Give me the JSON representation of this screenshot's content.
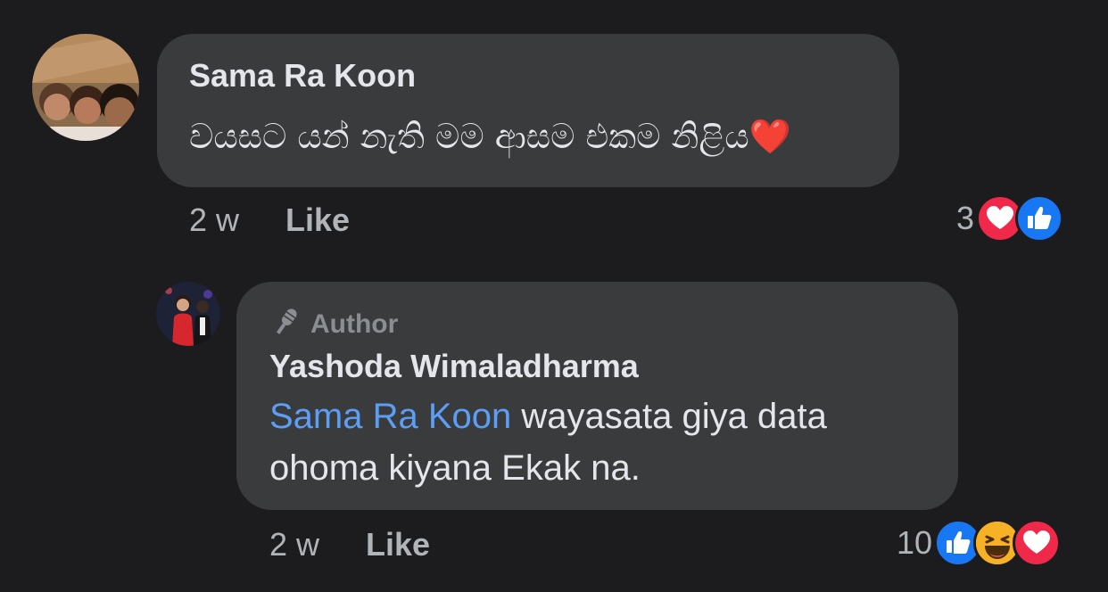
{
  "comments": [
    {
      "author": "Sama Ra Koon",
      "text": "වයසට යන් නැති මම ආසම එකම නිළිය",
      "emoji": "❤️",
      "time": "2 w",
      "like_label": "Like",
      "reaction_count": "3",
      "reactions": [
        "love-icon",
        "like-icon"
      ],
      "colors": {
        "love": "#f02849",
        "like": "#1877f2"
      }
    },
    {
      "badge": "Author",
      "author": "Yashoda Wimaladharma",
      "mention": "Sama Ra Koon",
      "text": " wayasata giya data ohoma kiyana Ekak na.",
      "time": "2 w",
      "like_label": "Like",
      "reaction_count": "10",
      "reactions": [
        "like-icon",
        "haha-icon",
        "love-icon"
      ],
      "colors": {
        "mention": "#5c9df5",
        "haha": "#f7b125"
      }
    }
  ]
}
